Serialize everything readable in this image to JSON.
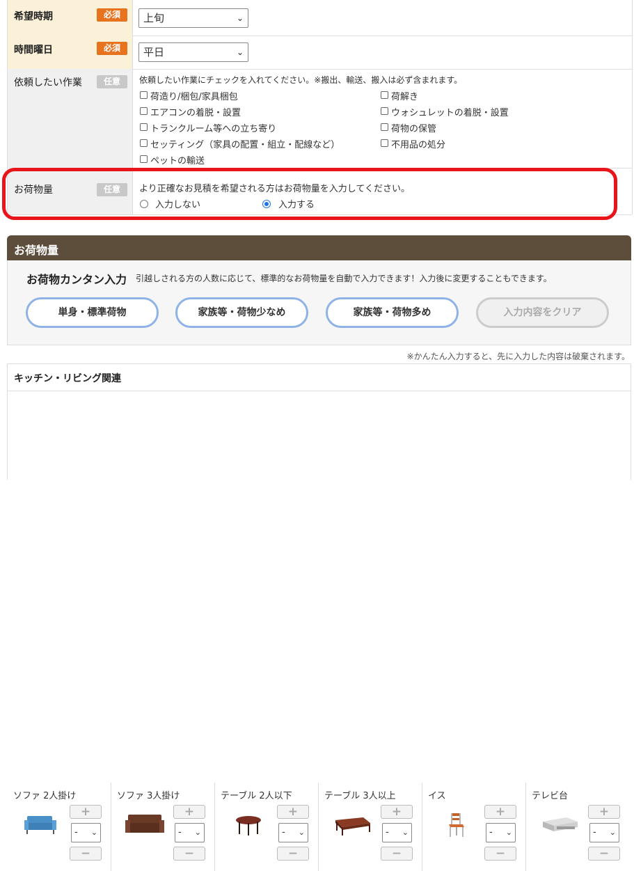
{
  "form": {
    "rows": [
      {
        "label": "希望時期",
        "badge": "必須",
        "value": "上旬"
      },
      {
        "label": "時間曜日",
        "badge": "必須",
        "value": "平日"
      },
      {
        "label": "依頼したい作業",
        "badge": "任意",
        "instruction": "依頼したい作業にチェックを入れてください。※搬出、輸送、搬入は必ず含まれます。"
      },
      {
        "label": "お荷物量",
        "badge": "任意",
        "instruction": "より正確なお見積を希望される方はお荷物量を入力してください。"
      }
    ],
    "tasks": {
      "left": [
        "荷造り/梱包/家具梱包",
        "エアコンの着脱・設置",
        "トランクルーム等への立ち寄り",
        "セッティング（家具の配置・組立・配線など）",
        "ペットの輸送"
      ],
      "right": [
        "荷解き",
        "ウォシュレットの着脱・設置",
        "荷物の保管",
        "不用品の処分"
      ]
    },
    "volume_options": [
      {
        "label": "入力しない",
        "selected": false
      },
      {
        "label": "入力する",
        "selected": true
      }
    ]
  },
  "panel": {
    "title": "お荷物量",
    "quick_title": "お荷物カンタン入力",
    "quick_desc": "引越しされる方の人数に応じて、標準的なお荷物量を自動で入力できます！入力後に変更することもできます。",
    "buttons": [
      "単身・標準荷物",
      "家族等・荷物少なめ",
      "家族等・荷物多め",
      "入力内容をクリア"
    ],
    "note": "※かんたん入力すると、先に入力した内容は破棄されます。"
  },
  "section": {
    "title": "キッチン・リビング関連",
    "items": [
      {
        "name": "ソファ 2人掛け",
        "qty": "-",
        "icon": "sofa-2-icon"
      },
      {
        "name": "ソファ 3人掛け",
        "qty": "-",
        "icon": "sofa-3-icon"
      },
      {
        "name": "テーブル 2人以下",
        "qty": "-",
        "icon": "round-table-icon"
      },
      {
        "name": "テーブル 3人以上",
        "qty": "-",
        "icon": "low-table-icon"
      },
      {
        "name": "イス",
        "qty": "-",
        "icon": "chair-icon"
      },
      {
        "name": "テレビ台",
        "qty": "-",
        "icon": "tv-stand-icon"
      }
    ],
    "plus": "+",
    "minus": "−"
  },
  "colors": {
    "accent": "#e8731f",
    "highlight": "#e8161b",
    "panel": "#5d4e3b",
    "pill_border": "#8fb3e6"
  }
}
